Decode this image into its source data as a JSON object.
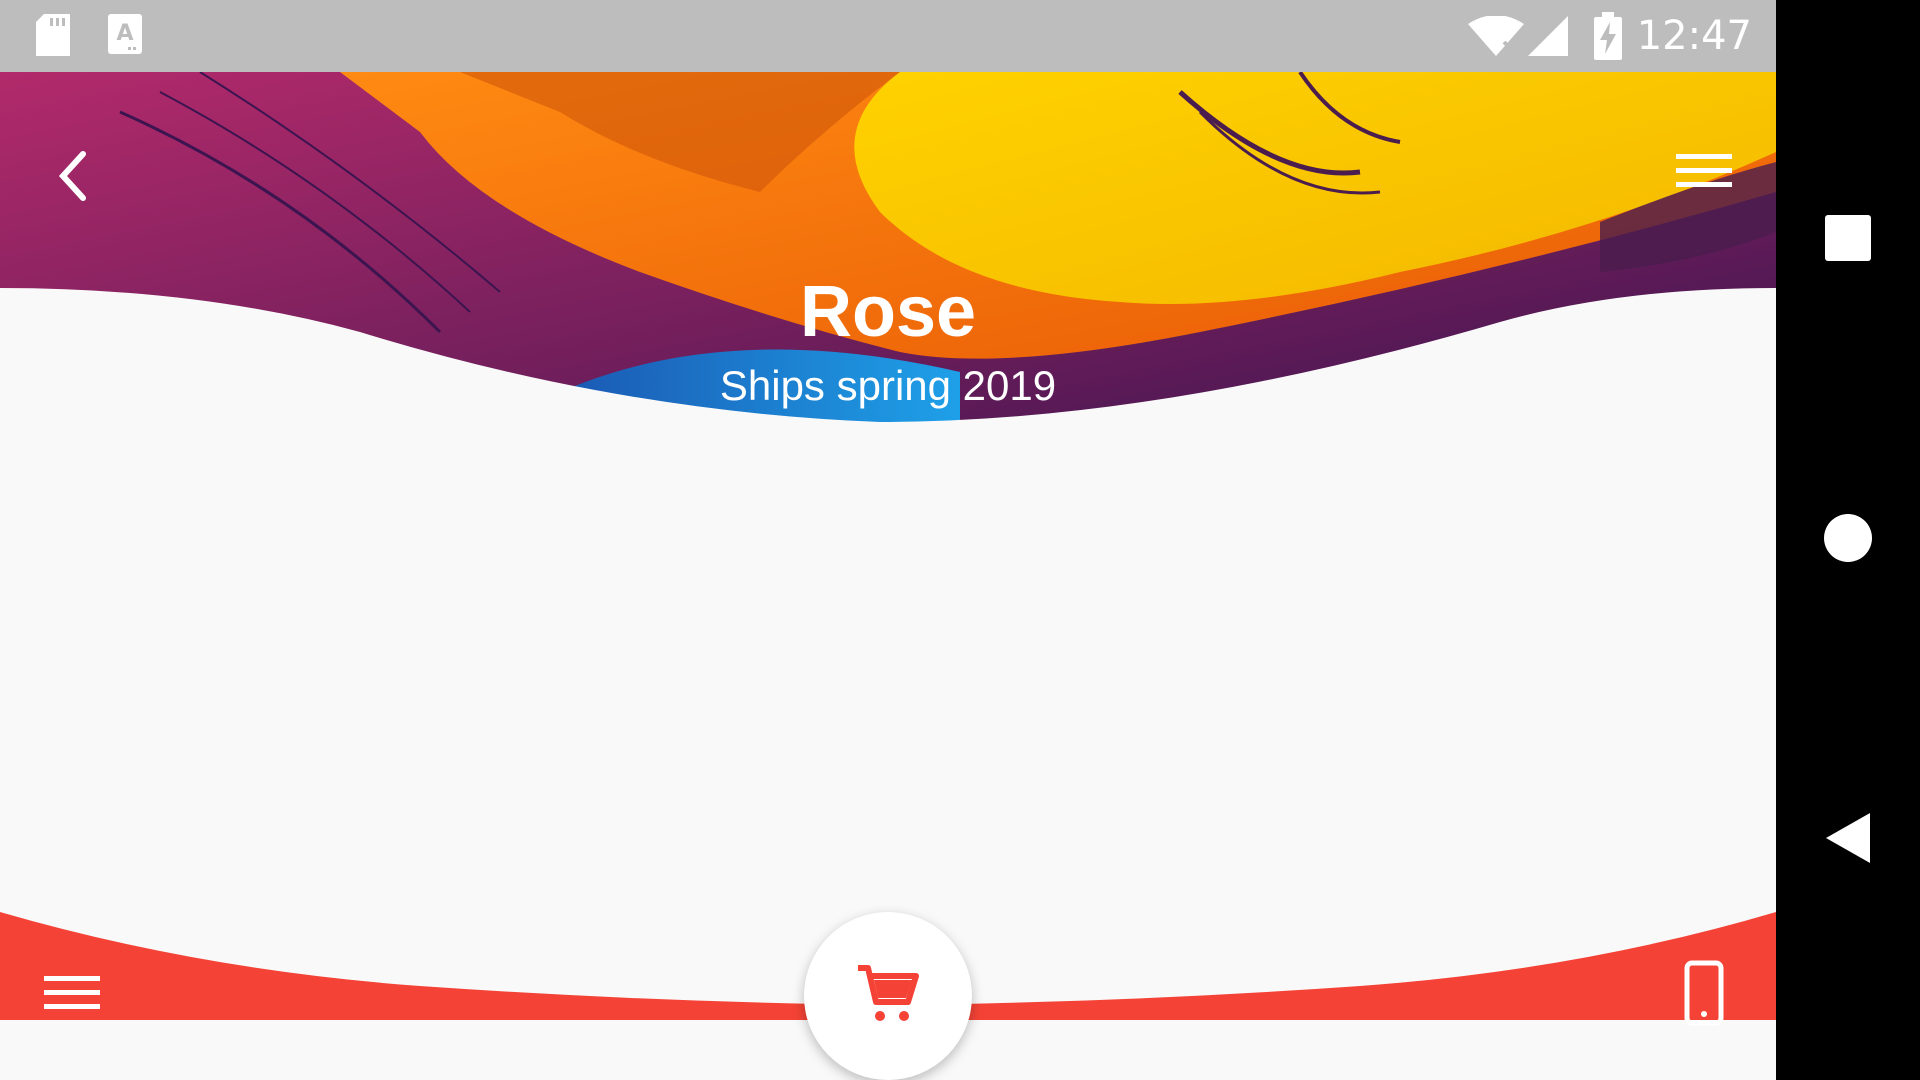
{
  "status_bar": {
    "time": "12:47",
    "icons": [
      "sd-card-icon",
      "keyboard-a-icon",
      "wifi-off-icon",
      "signal-icon",
      "battery-charging-icon"
    ]
  },
  "header": {
    "back_icon": "chevron-left-icon",
    "menu_icon": "hamburger-menu-icon",
    "title": "Rose",
    "subtitle": "Ships spring 2019"
  },
  "bottom_bar": {
    "color": "#f44336",
    "menu_icon": "hamburger-menu-icon",
    "fab_icon": "shopping-cart-icon",
    "device_icon": "smartphone-icon"
  },
  "nav_bar": {
    "buttons": [
      "recent-apps-icon",
      "home-icon",
      "back-triangle-icon"
    ]
  },
  "colors": {
    "accent": "#f44336",
    "status_bar": "#bdbdbd",
    "background": "#f9f9f9"
  }
}
